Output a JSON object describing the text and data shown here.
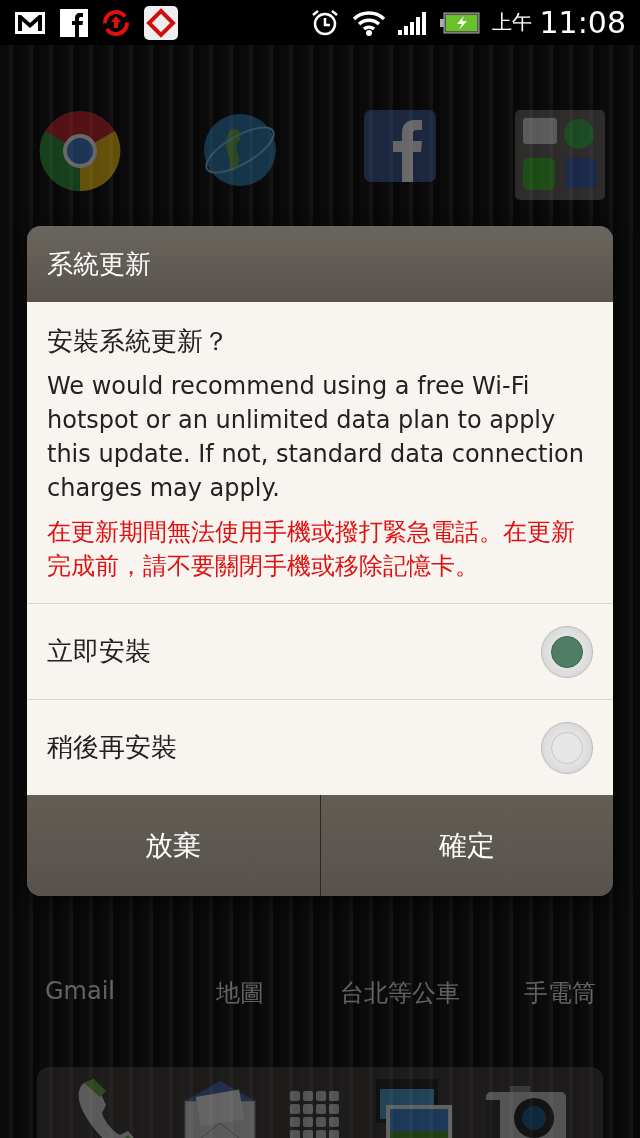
{
  "status_bar": {
    "period": "上午",
    "time": "11:08"
  },
  "home_screen": {
    "app_labels": [
      "Gmail",
      "地圖",
      "台北等公車",
      "手電筒"
    ]
  },
  "dialog": {
    "title": "系統更新",
    "question": "安裝系統更新？",
    "message": "We would recommend using a free Wi-Fi hotspot or an unlimited data plan to apply this update. If not, standard data connection charges may apply.",
    "warning": "在更新期間無法使用手機或撥打緊急電話。在更新完成前，請不要關閉手機或移除記憶卡。",
    "options": [
      {
        "label": "立即安裝",
        "selected": true
      },
      {
        "label": "稍後再安裝",
        "selected": false
      }
    ],
    "buttons": [
      "放棄",
      "確定"
    ]
  }
}
